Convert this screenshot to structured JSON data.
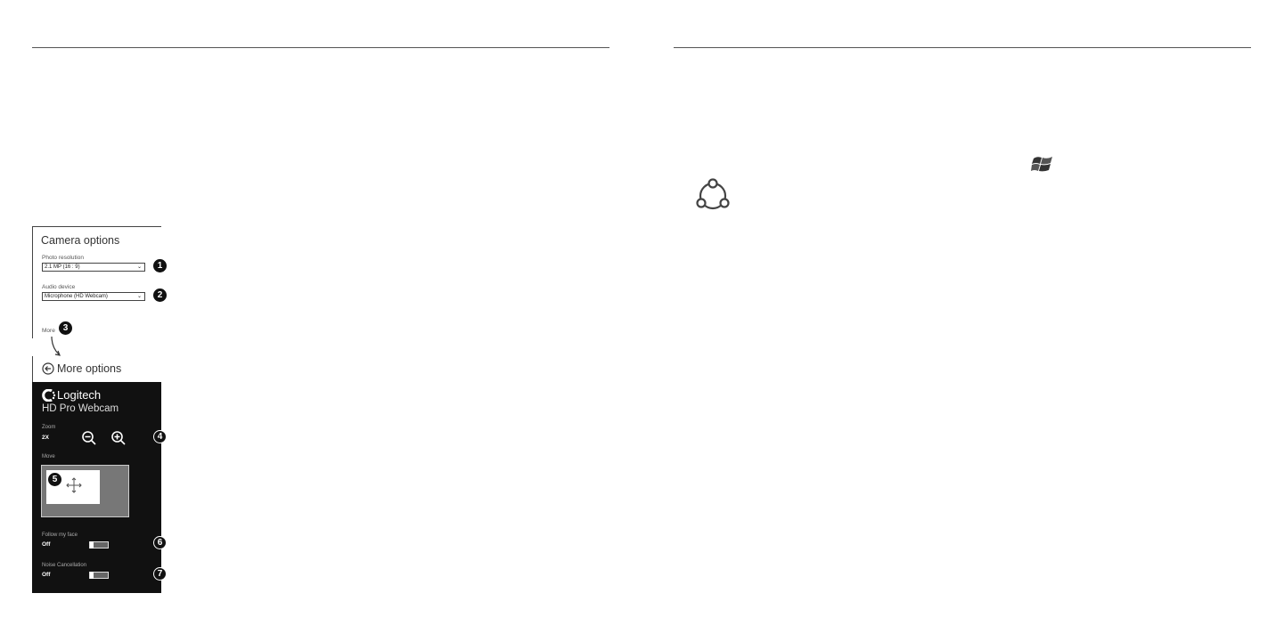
{
  "camera_options": {
    "title": "Camera options",
    "photo_resolution_label": "Photo resolution",
    "photo_resolution_value": "2.1 MP (16 : 9)",
    "audio_device_label": "Audio device",
    "audio_device_value": "Microphone (HD Webcam)",
    "more_label": "More"
  },
  "more_options": {
    "title": "More options",
    "brand": "Logitech",
    "product": "HD Pro Webcam",
    "zoom_label": "Zoom",
    "zoom_value": "2X",
    "move_label": "Move",
    "follow_face_label": "Follow my face",
    "follow_face_value": "Off",
    "noise_label": "Noise Cancellation",
    "noise_value": "Off"
  },
  "callouts": [
    "1",
    "2",
    "3",
    "4",
    "5",
    "6",
    "7"
  ],
  "icons": {
    "back": "back-arrow-icon",
    "zoom_out": "zoom-out-icon",
    "zoom_in": "zoom-in-icon",
    "move": "move-arrows-icon",
    "logo": "logitech-logo-icon",
    "windows": "windows-logo-icon",
    "charms": "charms-share-icon"
  }
}
